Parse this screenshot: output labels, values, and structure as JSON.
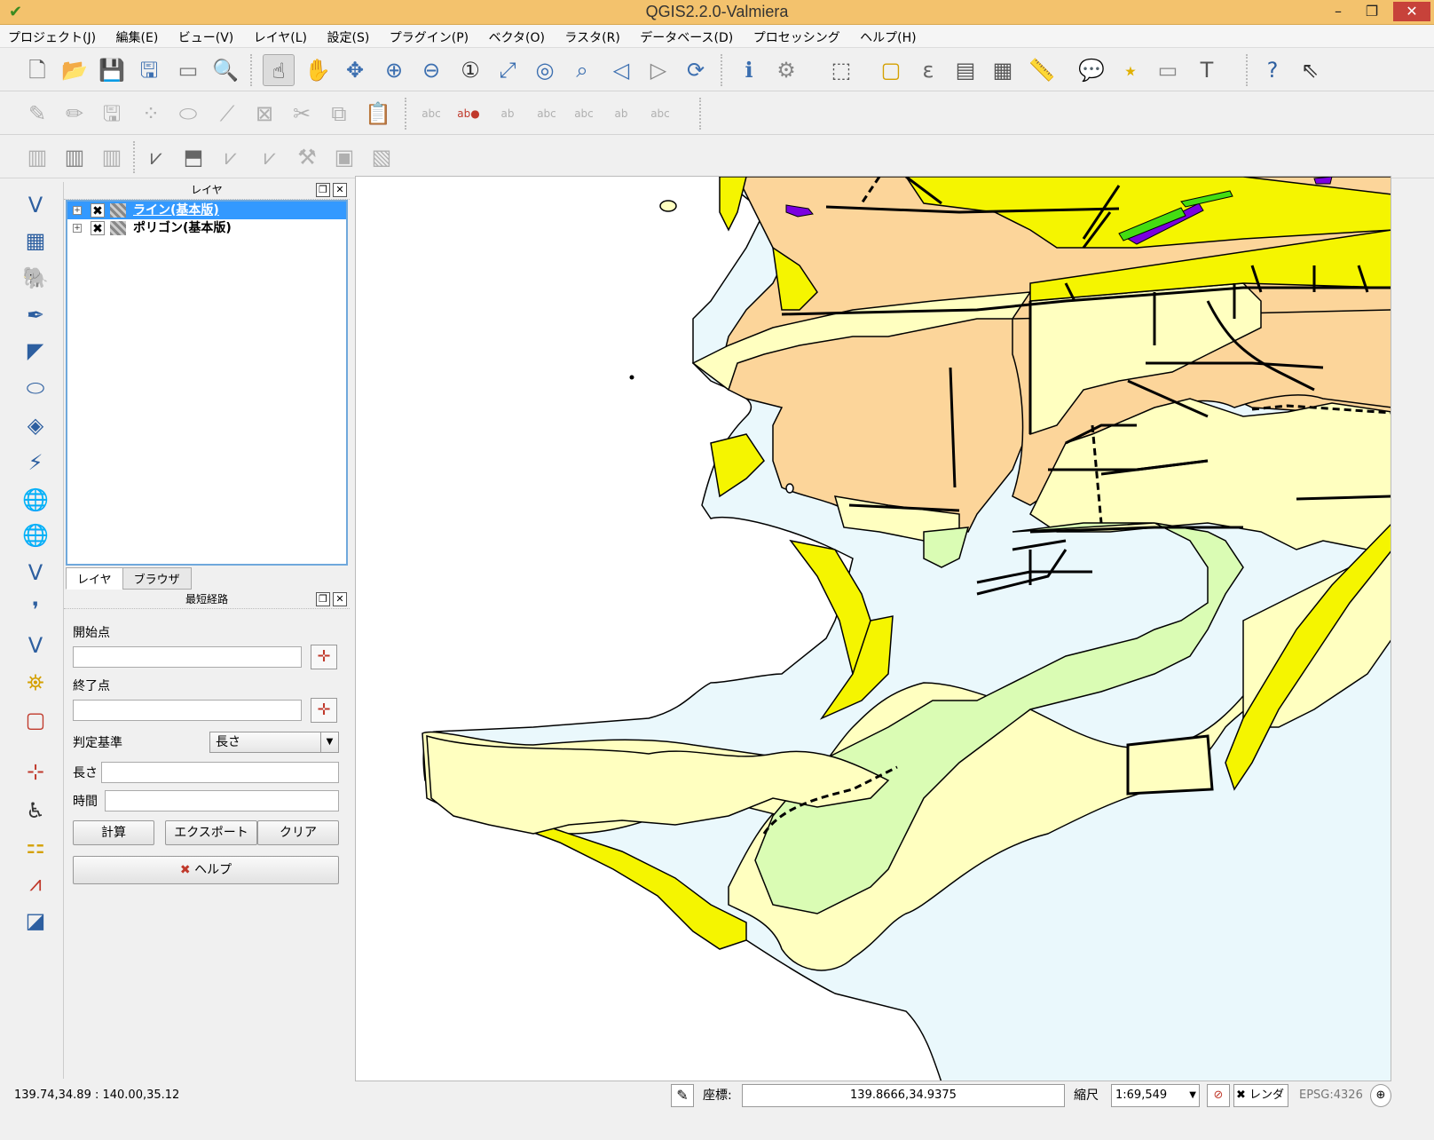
{
  "window": {
    "title": "QGIS2.2.0-Valmiera",
    "minimize": "–",
    "restore": "❐",
    "close": "✕"
  },
  "menu": [
    "プロジェクト(J)",
    "編集(E)",
    "ビュー(V)",
    "レイヤ(L)",
    "設定(S)",
    "プラグイン(P)",
    "ベクタ(O)",
    "ラスタ(R)",
    "データベース(D)",
    "プロセッシング",
    "ヘルプ(H)"
  ],
  "layers_panel": {
    "title": "レイヤ",
    "layers": [
      {
        "name": "ライン(基本版)",
        "visible": true,
        "selected": true
      },
      {
        "name": "ポリゴン(基本版)",
        "visible": true,
        "selected": false
      }
    ],
    "tabs": [
      "レイヤ",
      "ブラウザ"
    ]
  },
  "route_panel": {
    "title": "最短経路",
    "start_label": "開始点",
    "start_value": "",
    "end_label": "終了点",
    "end_value": "",
    "criterion_label": "判定基準",
    "criterion_value": "長さ",
    "length_label": "長さ",
    "length_value": "",
    "time_label": "時間",
    "time_value": "",
    "calc_button": "計算",
    "export_button": "エクスポート",
    "clear_button": "クリア",
    "help_button": "ヘルプ"
  },
  "status": {
    "extent": "139.74,34.89 : 140.00,35.12",
    "coord_label": "座標:",
    "coord_value": "139.8666,34.9375",
    "scale_label": "縮尺",
    "scale_value": "1:69,549",
    "render_label": "レンダ",
    "crs": "EPSG:4326"
  },
  "colors": {
    "titlebar": "#f3c26d",
    "water": "#eaf8fc",
    "orange": "#fcd59a",
    "yellow": "#f5f500",
    "lightyellow": "#ffffc0",
    "lightgreen": "#dafcb4",
    "purple": "#7b00e0",
    "green": "#44dd11"
  }
}
